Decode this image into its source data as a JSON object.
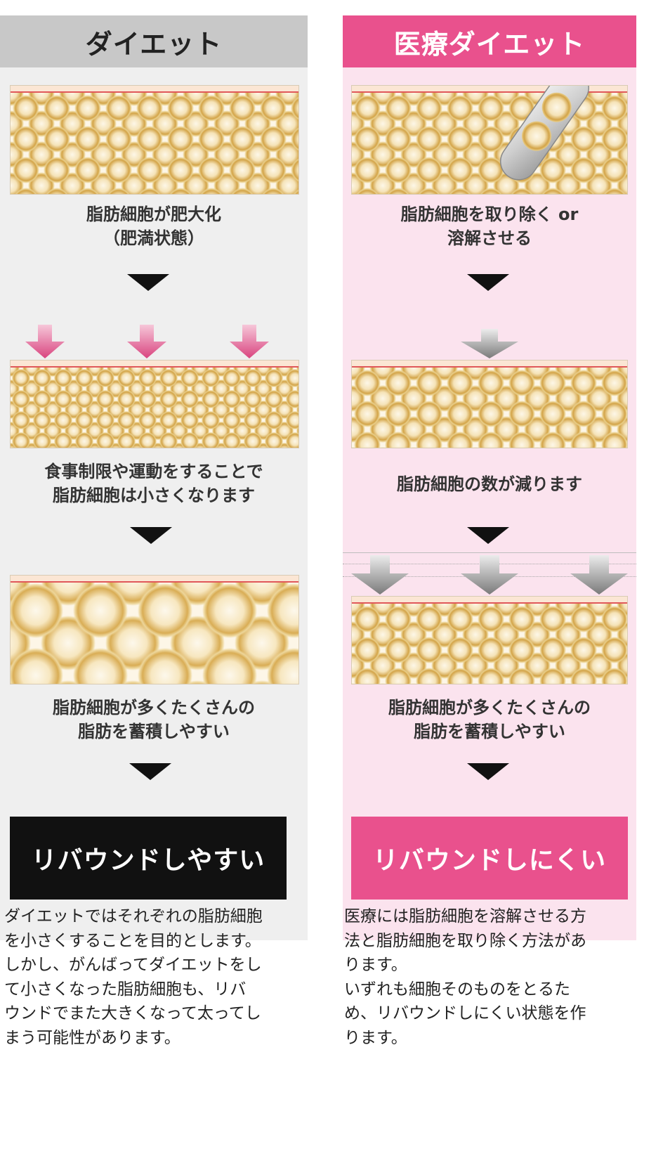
{
  "left": {
    "heading": "ダイエット",
    "caption_1": [
      "脂肪細胞が肥大化",
      "（肥満状態）"
    ],
    "caption_2": [
      "食事制限や運動をすることで",
      "脂肪細胞は小さくなります"
    ],
    "caption_3": [
      "脂肪細胞が多くたくさんの",
      "脂肪を蓄積しやすい"
    ],
    "result": "リバウンドしやすい",
    "description": [
      "ダイエットではそれぞれの脂肪細胞",
      "を小さくすることを目的とします。",
      "しかし、がんばってダイエットをし",
      "て小さくなった脂肪細胞も、リバ",
      "ウンドでまた大きくなって太ってし",
      "まう可能性があります。"
    ]
  },
  "right": {
    "heading": "医療ダイエット",
    "caption_1": [
      "脂肪細胞を取り除く or",
      "溶解させる"
    ],
    "caption_2": [
      "脂肪細胞の数が減ります"
    ],
    "caption_3": [
      "脂肪細胞が多くたくさんの",
      "脂肪を蓄積しやすい"
    ],
    "result": "リバウンドしにくい",
    "description": [
      "医療には脂肪細胞を溶解させる方",
      "法と脂肪細胞を取り除く方法があ",
      "ります。",
      "いずれも細胞そのものをとるた",
      "め、リバウンドしにくい状態を作",
      "ります。"
    ]
  },
  "colors": {
    "accent_pink": "#e9518d",
    "left_panel": "#efefef",
    "right_panel": "#fbe3ee",
    "left_heading": "#c8c8c8",
    "skin_line": "#e0585a"
  }
}
